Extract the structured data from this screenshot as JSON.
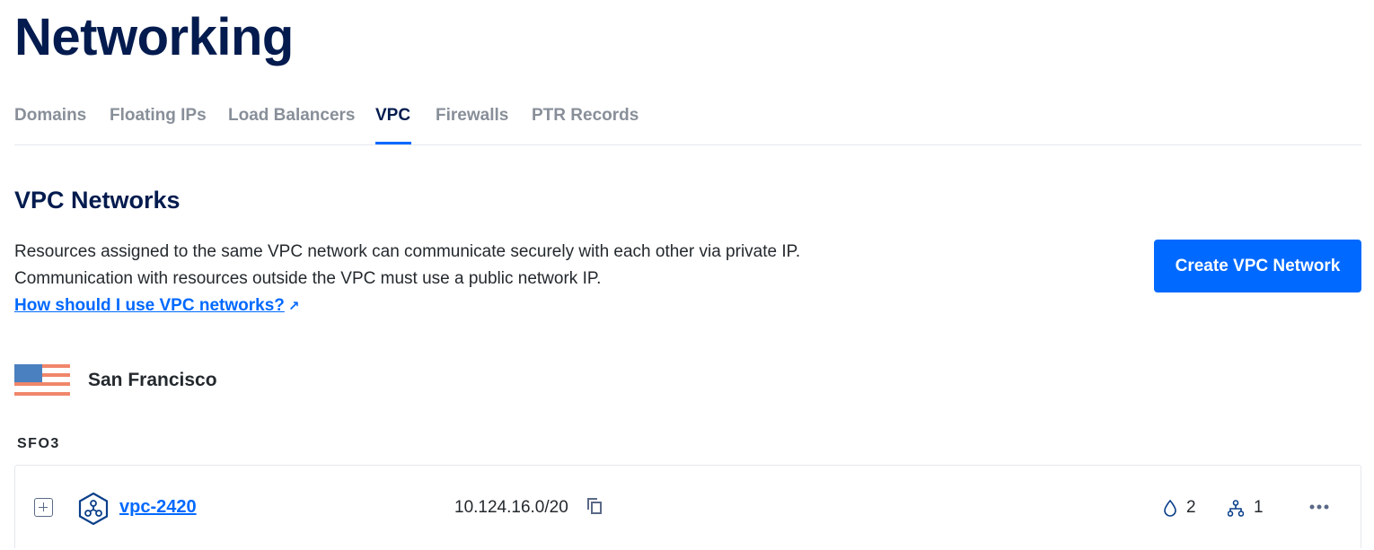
{
  "page": {
    "title": "Networking"
  },
  "tabs": [
    {
      "label": "Domains",
      "active": false
    },
    {
      "label": "Floating IPs",
      "active": false
    },
    {
      "label": "Load Balancers",
      "active": false
    },
    {
      "label": "VPC",
      "active": true
    },
    {
      "label": "Firewalls",
      "active": false
    },
    {
      "label": "PTR Records",
      "active": false
    }
  ],
  "section": {
    "title": "VPC Networks",
    "description_line1": "Resources assigned to the same VPC network can communicate securely with each other via private IP.",
    "description_line2": "Communication with resources outside the VPC must use a public network IP.",
    "help_link": "How should I use VPC networks?",
    "create_button": "Create VPC Network"
  },
  "region": {
    "flag_icon": "us-flag-icon",
    "name": "San Francisco",
    "datacenter": "SFO3"
  },
  "vpcs": [
    {
      "name": "vpc-2420",
      "ip_range": "10.124.16.0/20",
      "droplet_count": "2",
      "member_count": "1"
    }
  ],
  "colors": {
    "accent": "#0069ff",
    "heading": "#031b4e",
    "muted_tab": "#888f99",
    "flag_blue": "#4a80bf",
    "flag_stripe": "#f0866a"
  }
}
